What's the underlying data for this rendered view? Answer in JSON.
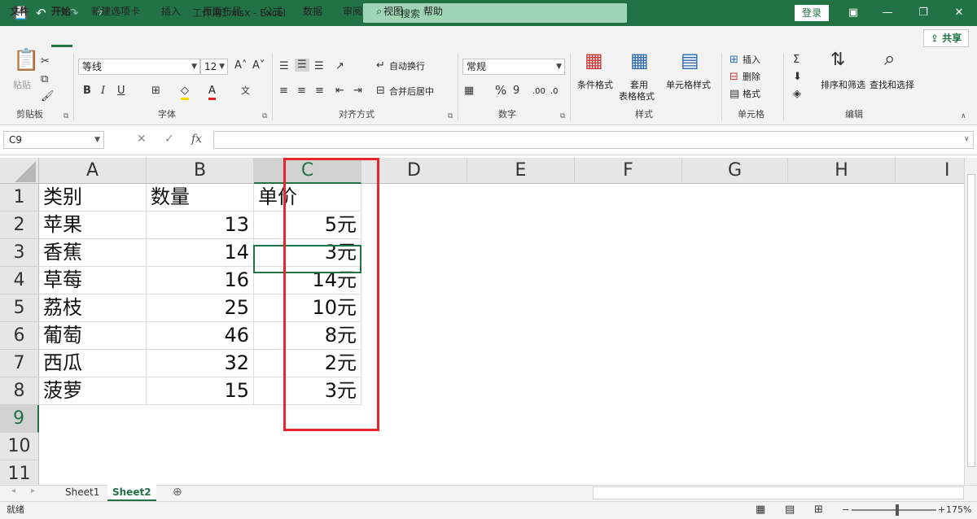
{
  "titlebar": {
    "save_icon": "💾",
    "undo_icon": "↶",
    "redo_icon": "↷",
    "customize_icon": "▿",
    "doc_title": "工作用1.xlsx  -  Excel",
    "search_icon": "⌕",
    "search_placeholder": "搜索",
    "login_label": "登录",
    "layout_icon": "▣",
    "minimize_icon": "—",
    "restore_icon": "❐",
    "close_icon": "✕"
  },
  "menu": {
    "items": [
      "文件",
      "开始",
      "新建选项卡",
      "插入",
      "页面布局",
      "公式",
      "数据",
      "审阅",
      "视图",
      "帮助"
    ],
    "active_index": 1,
    "share_label": "共享"
  },
  "ribbon": {
    "clipboard": {
      "paste": "粘贴",
      "group": "剪贴板"
    },
    "font": {
      "name": "等线",
      "size": "12",
      "bold": "B",
      "italic": "I",
      "underline": "U",
      "group": "字体",
      "grow": "A˄",
      "shrink": "A˅",
      "phonetic": "文"
    },
    "alignment": {
      "wrap": "自动换行",
      "merge": "合并后居中",
      "group": "对齐方式"
    },
    "number": {
      "format": "常规",
      "percent": "%",
      "comma": "9",
      "inc_dec": ".00",
      "dec_dec": ".0",
      "group": "数字"
    },
    "styles": {
      "conditional": "条件格式",
      "table_1": "套用",
      "table_2": "表格格式",
      "cell_styles": "单元格样式",
      "group": "样式"
    },
    "cells": {
      "insert": "插入",
      "delete": "删除",
      "format": "格式",
      "group": "单元格"
    },
    "editing": {
      "sort": "排序和筛选",
      "find": "查找和选择",
      "group": "编辑"
    }
  },
  "formula_bar": {
    "name_box": "C9",
    "cancel_icon": "✕",
    "enter_icon": "✓",
    "fx_icon": "fx",
    "value": ""
  },
  "sheet": {
    "columns": [
      "A",
      "B",
      "C",
      "D",
      "E",
      "F",
      "G",
      "H",
      "I"
    ],
    "rows": [
      "1",
      "2",
      "3",
      "4",
      "5",
      "6",
      "7",
      "8",
      "9",
      "10",
      "11"
    ],
    "cells": [
      [
        "类别",
        "数量",
        "单价"
      ],
      [
        "苹果",
        "13",
        "5元"
      ],
      [
        "香蕉",
        "14",
        "3元"
      ],
      [
        "草莓",
        "16",
        "14元"
      ],
      [
        "荔枝",
        "25",
        "10元"
      ],
      [
        "葡萄",
        "46",
        "8元"
      ],
      [
        "西瓜",
        "32",
        "2元"
      ],
      [
        "菠萝",
        "15",
        "3元"
      ]
    ],
    "selected_cell": "C9",
    "highlight_color": "#e8262b"
  },
  "sheet_tabs": {
    "tabs": [
      "Sheet1",
      "Sheet2"
    ],
    "active": "Sheet2",
    "add_icon": "⊕"
  },
  "status": {
    "text": "就绪",
    "zoom": "175%",
    "zoom_out": "−",
    "zoom_in": "+"
  },
  "colors": {
    "accent": "#217346"
  }
}
